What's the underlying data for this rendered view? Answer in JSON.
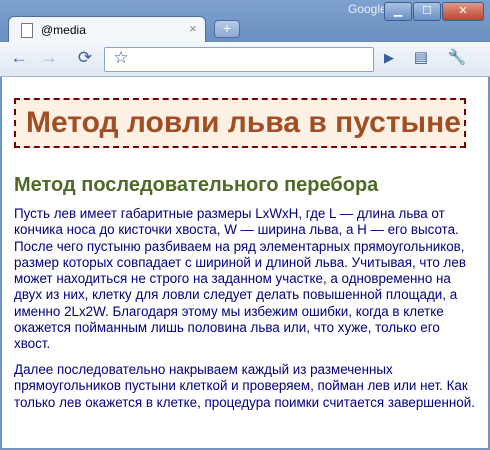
{
  "window": {
    "brand_label": "Google",
    "buttons": {
      "minimize": "▁",
      "maximize": "☐",
      "close": "✕"
    }
  },
  "tab": {
    "title": "@media",
    "close": "×"
  },
  "new_tab": "+",
  "toolbar": {
    "back": "←",
    "forward": "→",
    "reload": "⟳",
    "bookmark": "☆",
    "go": "▶",
    "page_menu": "▤",
    "tools_menu": "🔧",
    "address_value": ""
  },
  "page": {
    "heading": "Метод ловли льва в пустыне",
    "subheading": "Метод последовательного перебора",
    "paragraphs": [
      "Пусть лев имеет габаритные размеры LxWxH, где L — длина льва от кончика носа до кисточки хвоста, W — ширина льва, а H — его высота. После чего пустыню разбиваем на ряд элементарных прямоугольников, размер которых совпадает с шириной и длиной льва. Учитывая, что лев может находиться не строго на заданном участке, а одновременно на двух из них, клетку для ловли следует делать повышенной площади, а именно 2Lx2W. Благодаря этому мы избежим ошибки, когда в клетке окажется пойманным лишь половина льва или, что хуже, только его хвост.",
      "Далее последовательно накрываем каждый из размеченных прямоугольников пустыни клеткой и проверяем, пойман лев или нет. Как только лев окажется в клетке, процедура поимки считается завершенной."
    ]
  }
}
